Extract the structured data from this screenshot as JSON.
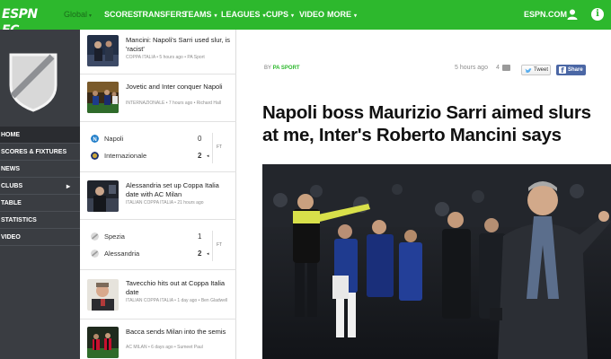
{
  "nav": {
    "logo": "ESPN FC",
    "edition": "Global",
    "items": [
      {
        "label": "SCORES",
        "caret": ""
      },
      {
        "label": "TRANSFERS",
        "caret": ""
      },
      {
        "label": "TEAMS",
        "caret": "▾"
      },
      {
        "label": "LEAGUES",
        "caret": "▾"
      },
      {
        "label": "CUPS",
        "caret": "▾"
      },
      {
        "label": "VIDEO",
        "caret": ""
      },
      {
        "label": "MORE",
        "caret": "▾"
      }
    ],
    "espn_link": "ESPN.COM",
    "info_glyph": "i",
    "colors": {
      "brand": "#2db82d",
      "sidebar": "#3a3d42"
    }
  },
  "sidebar": {
    "items": [
      {
        "label": "HOME",
        "chevron": ""
      },
      {
        "label": "SCORES & FIXTURES",
        "chevron": ""
      },
      {
        "label": "NEWS",
        "chevron": ""
      },
      {
        "label": "CLUBS",
        "chevron": "▸"
      },
      {
        "label": "TABLE",
        "chevron": ""
      },
      {
        "label": "STATISTICS",
        "chevron": ""
      },
      {
        "label": "VIDEO",
        "chevron": ""
      }
    ]
  },
  "feed": {
    "stories": [
      {
        "title": "Mancini: Napoli's Sarri used slur, is 'racist'",
        "meta": "COPPA ITALIA • 5 hours ago • PA Sport"
      },
      {
        "title": "Jovetic and Inter conquer Napoli",
        "meta": "INTERNAZIONALE • 7 hours ago • Richard Hall"
      },
      {
        "title": "Alessandria set up Coppa Italia date with AC Milan",
        "meta": "ITALIAN COPPA ITALIA • 21 hours ago"
      },
      {
        "title": "Tavecchio hits out at Coppa Italia date",
        "meta": "ITALIAN COPPA ITALIA • 1 day ago • Ben Gladwell"
      },
      {
        "title": "Bacca sends Milan into the semis",
        "meta": "AC MILAN • 6 days ago • Sumeet Paul"
      }
    ],
    "results": [
      {
        "status": "FT",
        "teams": [
          {
            "name": "Napoli",
            "score": "0",
            "winner": false
          },
          {
            "name": "Internazionale",
            "score": "2",
            "winner": true,
            "win_mark": "◂"
          }
        ]
      },
      {
        "status": "FT",
        "teams": [
          {
            "name": "Spezia",
            "score": "1",
            "winner": false
          },
          {
            "name": "Alessandria",
            "score": "2",
            "winner": true,
            "win_mark": "◂"
          }
        ]
      }
    ]
  },
  "article": {
    "byline_prefix": "BY",
    "byline_source": "PA SPORT",
    "timestamp": "5 hours ago",
    "comment_count": "4",
    "tweet_label": "Tweet",
    "share_label": "Share",
    "share_glyph": "f",
    "headline": "Napoli boss Maurizio Sarri aimed slurs at me, Inter's Roberto Mancini says"
  }
}
